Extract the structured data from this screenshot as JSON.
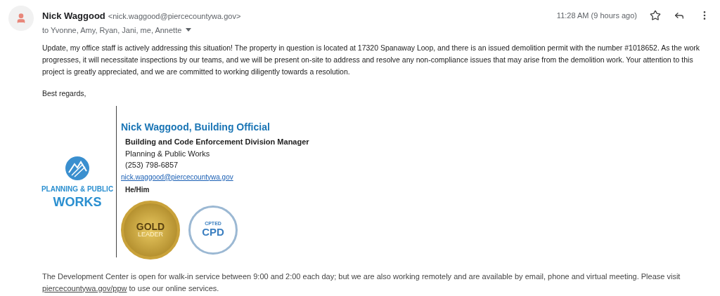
{
  "header": {
    "sender_name": "Nick Waggood",
    "sender_email": "<nick.waggood@piercecountywa.gov>",
    "recipients": "to Yvonne, Amy, Ryan, Jani, me, Annette",
    "time": "11:28 AM (9 hours ago)",
    "starred": false
  },
  "body": [
    "Update, my office staff is actively addressing this situation! The property in question is located at 17320 Spanaway Loop, and there is an issued demolition permit with the number #1018652. As the work progresses, it will necessitate inspections by our teams, and we will be present on-site to address and resolve any non-compliance issues that may arise from the demolition work. Your attention to this project is greatly appreciated, and we are committed to working diligently towards a resolution.",
    "Best regards,"
  ],
  "signature": {
    "logo_lines": [
      "PLANNING & PUBLIC",
      "WORKS"
    ],
    "name_title": "Nick Waggood, Building Official",
    "position": "Building and Code Enforcement Division Manager",
    "department": "Planning & Public Works",
    "phone": "(253) 798-6857",
    "email": "nick.waggood@piercecountywa.gov",
    "pronouns": "He/Him",
    "badges": [
      {
        "kind": "gold",
        "lines": [
          "GOLD",
          "LEADER"
        ]
      },
      {
        "kind": "cpd",
        "lines": [
          "CPTED",
          "CPD"
        ]
      }
    ]
  },
  "footer": {
    "text": "The Development Center is open for walk-in service between 9:00 and 2:00 each day; but we are also working remotely and are available by email, phone and virtual meeting. Please visit",
    "link": "piercecountywa.gov/ppw",
    "after": "to use our online services."
  }
}
